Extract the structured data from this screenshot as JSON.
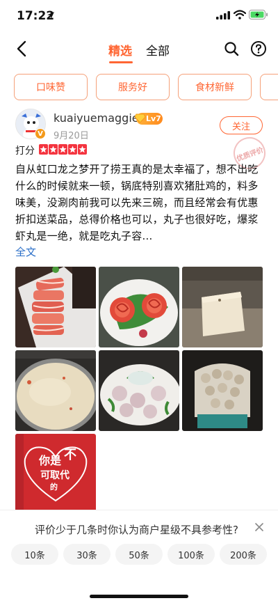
{
  "status_bar": {
    "time": "17:22"
  },
  "nav": {
    "tab_featured": "精选",
    "tab_all": "全部"
  },
  "tags": [
    "口味赞",
    "服务好",
    "食材新鲜",
    ""
  ],
  "review": {
    "username": "kuaiyuemaggie",
    "level": "Lv7",
    "date": "9月20日",
    "follow": "关注",
    "stamp": "优质评价",
    "rating_label": "打分",
    "stars": 5,
    "text": "自从虹口龙之梦开了捞王真的是太幸福了，想不出吃什么的时候就来一顿，锅底特别喜欢猪肚鸡的，料多味美，没涮肉前我可以先来三碗，而且经常会有优惠折扣送菜品，总得价格也可以，丸子也很好吃，爆浆虾丸是一绝，就是吃丸子容…",
    "full_text": "全文",
    "avatar_badge": "V"
  },
  "photos": {
    "last_caption_lines": [
      "你是",
      "不",
      "可取代",
      "的"
    ]
  },
  "survey": {
    "question": "评价少于几条时你认为商户星级不具参考性?",
    "options": [
      "10条",
      "30条",
      "50条",
      "100条",
      "200条"
    ]
  },
  "colors": {
    "accent": "#ff6633",
    "star": "#f4343f",
    "link": "#2b6fc8"
  }
}
